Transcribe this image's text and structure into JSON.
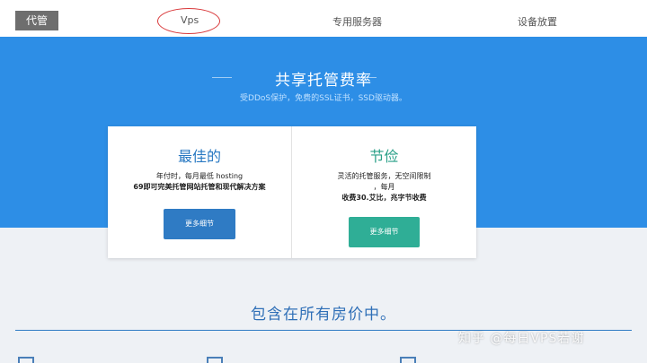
{
  "nav": {
    "tag": "代管",
    "items": [
      "Vps",
      "专用服务器",
      "设备放置"
    ]
  },
  "hero": {
    "title": "共享托管费率",
    "subtitle": "受DDoS保护，免费的SSL证书，SSD驱动器。"
  },
  "cards": [
    {
      "title": "最佳的",
      "line1": "年付时，每月最低 hosting",
      "line2": "69即可完美托管网站托管和现代解决方案",
      "button": "更多细节"
    },
    {
      "title": "节俭",
      "line1": "灵活的托管服务，无空间限制",
      "line2": "，每月",
      "line3": "收费30.艾比，兆字节收费",
      "button": "更多细节"
    }
  ],
  "included": {
    "title": "包含在所有房价中。"
  },
  "watermark": "知乎 @每日VPS若谢",
  "colors": {
    "hero": "#2d8ee6",
    "primary_button": "#2f7bc4",
    "secondary_button": "#2fae96",
    "annotation": "#d9383a"
  }
}
